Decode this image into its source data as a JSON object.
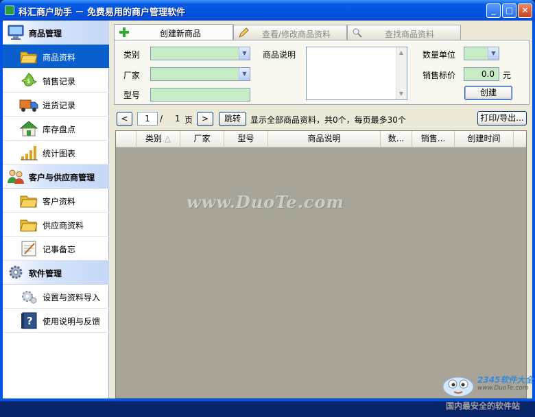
{
  "window": {
    "title": "科汇商户助手 － 免费易用的商户管理软件",
    "controls": {
      "minimize": "_",
      "maximize": "□",
      "close": "✕"
    }
  },
  "sidebar": {
    "sections": [
      {
        "label": "商品管理",
        "icon": "monitor-icon",
        "items": [
          {
            "label": "商品资料",
            "icon": "folder-open-icon",
            "active": true
          },
          {
            "label": "销售记录",
            "icon": "money-icon"
          },
          {
            "label": "进货记录",
            "icon": "truck-icon"
          },
          {
            "label": "库存盘点",
            "icon": "warehouse-icon"
          },
          {
            "label": "统计图表",
            "icon": "bar-chart-icon"
          }
        ]
      },
      {
        "label": "客户与供应商管理",
        "icon": "users-icon",
        "items": [
          {
            "label": "客户资料",
            "icon": "folder-open-icon"
          },
          {
            "label": "供应商资料",
            "icon": "folder-open-icon"
          },
          {
            "label": "记事备忘",
            "icon": "notepad-icon"
          }
        ]
      },
      {
        "label": "软件管理",
        "icon": "gear-icon",
        "items": [
          {
            "label": "设置与资料导入",
            "icon": "settings-icon"
          },
          {
            "label": "使用说明与反馈",
            "icon": "help-book-icon"
          }
        ]
      }
    ]
  },
  "tabs": [
    {
      "label": "创建新商品",
      "icon": "plus-icon",
      "active": true
    },
    {
      "label": "查看/修改商品资料",
      "icon": "pencil-icon"
    },
    {
      "label": "查找商品资料",
      "icon": "magnifier-icon"
    }
  ],
  "form": {
    "category_label": "类别",
    "vendor_label": "厂家",
    "model_label": "型号",
    "description_label": "商品说明",
    "unit_label": "数量单位",
    "price_label": "销售标价",
    "price_value": "0.0",
    "currency_label": "元",
    "create_button": "创建"
  },
  "pager": {
    "prev": "<",
    "current_page": "1",
    "separator": "/",
    "total_pages": "1",
    "page_label": "页",
    "next": ">",
    "jump_button": "跳转",
    "status": "显示全部商品资料，共0个，每页最多30个",
    "print_button": "打印/导出..."
  },
  "grid": {
    "sort_indicator": "△",
    "columns": [
      "类别",
      "厂家",
      "型号",
      "商品说明",
      "数...",
      "销售...",
      "创建时间"
    ],
    "rows": []
  },
  "watermark": {
    "text": "www.DuoTe.com",
    "logo_main": "2345软件大全",
    "logo_url": "www.DuoTe.com",
    "logo_slogan": "国内最安全的软件站"
  },
  "colors": {
    "title_bar": "#0054e3",
    "active_nav": "#0a5fcf",
    "field_fill": "#c8ecc4",
    "grid_background": "#a8a598"
  }
}
